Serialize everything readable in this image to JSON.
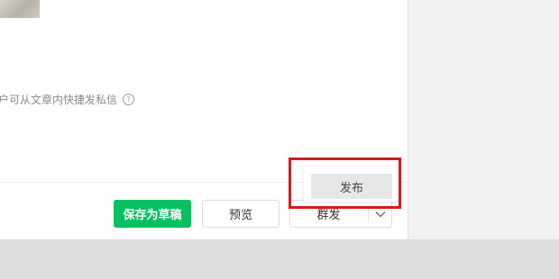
{
  "editor": {
    "hint_text": "户可从文章内快捷发私信",
    "help_icon": "question-circle-icon",
    "help_glyph": "?"
  },
  "actions": {
    "save_draft_label": "保存为草稿",
    "preview_label": "预览",
    "mass_send_label": "群发",
    "mass_send_dropdown_icon": "chevron-down-icon"
  },
  "dropdown_menu": {
    "items": [
      {
        "label": "发布",
        "highlighted": true
      }
    ]
  },
  "colors": {
    "primary_green": "#07c160",
    "highlight_red": "#d11e1e",
    "menu_item_bg": "#e7e7ea"
  }
}
